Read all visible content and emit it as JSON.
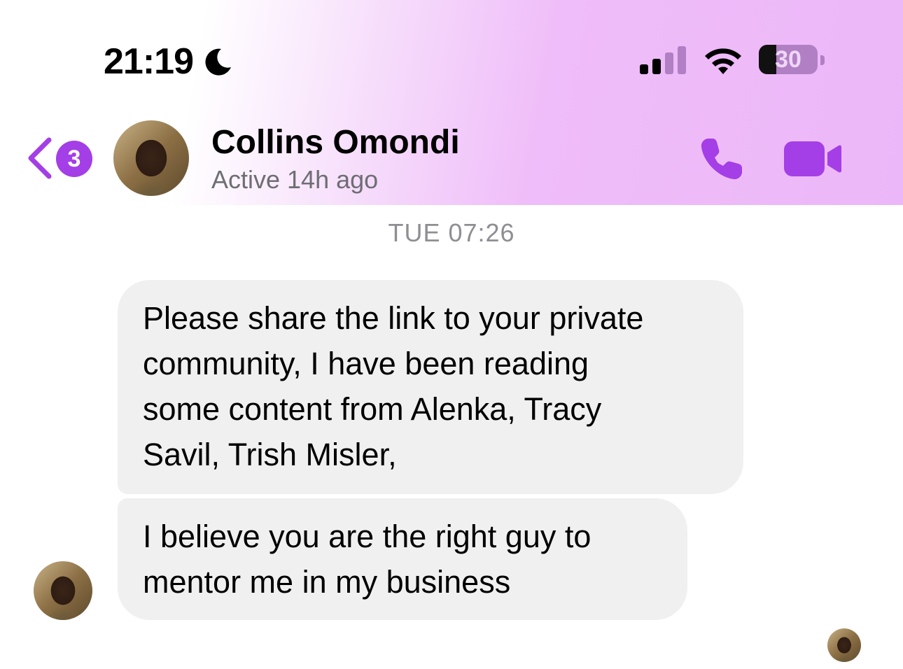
{
  "status_bar": {
    "time": "21:19",
    "focus_icon": "moon-icon",
    "signal_icon": "cellular-signal-icon",
    "wifi_icon": "wifi-icon",
    "battery_level": "30",
    "battery_fraction": 0.3
  },
  "nav": {
    "back_icon": "chevron-left-icon",
    "unread_count": "3"
  },
  "contact": {
    "name": "Collins Omondi",
    "status": "Active 14h ago",
    "call_icon": "phone-icon",
    "video_icon": "video-camera-icon"
  },
  "conversation": {
    "timestamp": "TUE 07:26",
    "messages": [
      {
        "lines": [
          "Please share the link to your private",
          "community, I have been reading",
          "some content from Alenka, Tracy",
          "Savil, Trish Misler,"
        ]
      },
      {
        "lines": [
          "I believe you are the right guy to",
          "mentor me in my business"
        ]
      }
    ]
  },
  "colors": {
    "accent": "#a43ee6",
    "bubble_incoming": "#f0f0f0",
    "header_gradient_end": "#ecb7f8"
  }
}
